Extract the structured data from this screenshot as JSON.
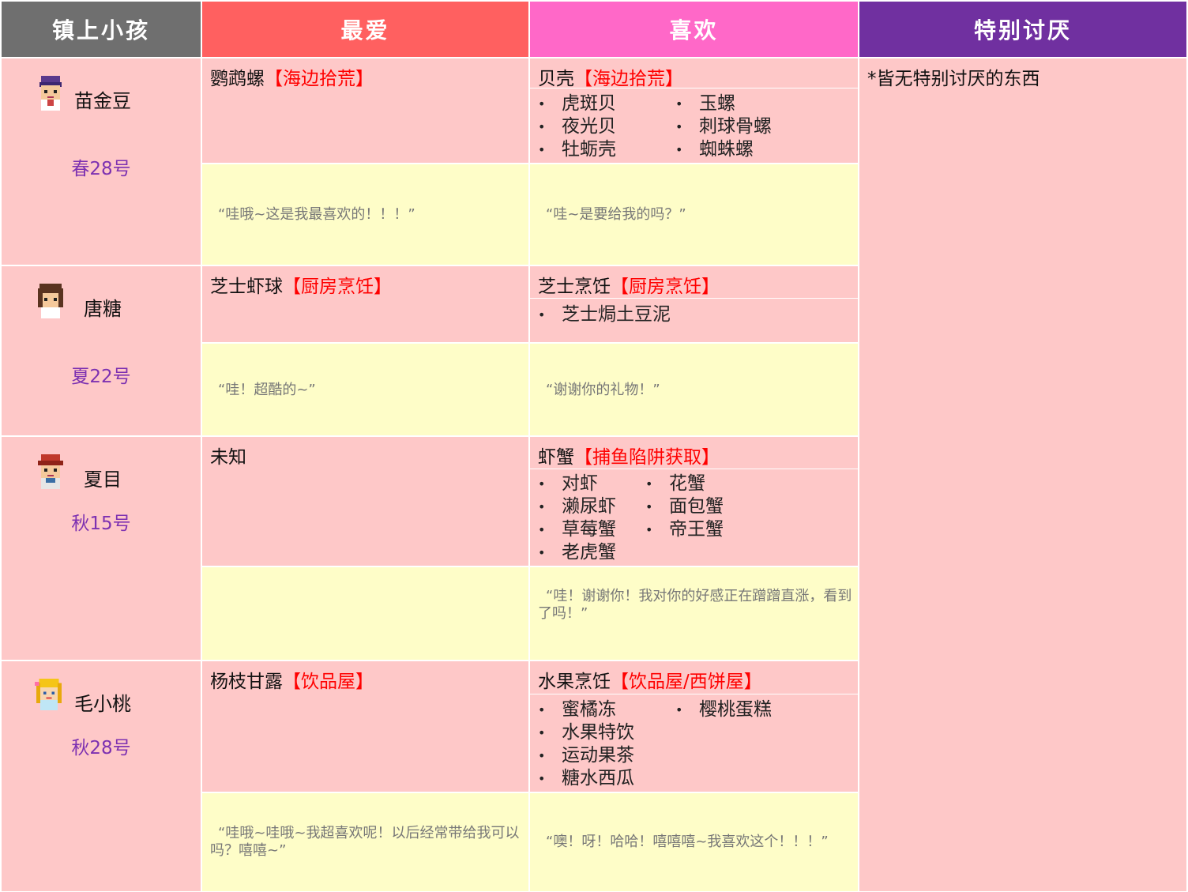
{
  "headers": {
    "kids": "镇上小孩",
    "love": "最爱",
    "like": "喜欢",
    "hate": "特别讨厌"
  },
  "colors": {
    "kids_header": "#6f6f6f",
    "love_header": "#ff6060",
    "like_header": "#ff68c8",
    "hate_header": "#7030a0",
    "pink_cell": "#fec8c8",
    "yellow_cell": "#fefdc8",
    "birthday_text": "#7d31b1",
    "source_text": "#ff0000"
  },
  "hate_text": "*皆无特别讨厌的东西",
  "kids": [
    {
      "name": "苗金豆",
      "birthday": "春28号",
      "avatar": "purple-hair-boy-icon",
      "love_item": "鹦鹉螺",
      "love_source": "【海边拾荒】",
      "love_quote": "“哇哦~这是我最喜欢的！！！”",
      "like_item": "贝壳",
      "like_source": "【海边拾荒】",
      "like_col1": [
        "虎斑贝",
        "夜光贝",
        "牡蛎壳"
      ],
      "like_col2": [
        "玉螺",
        "刺球骨螺",
        "蜘蛛螺"
      ],
      "like_quote": "“哇~是要给我的吗？”"
    },
    {
      "name": "唐糖",
      "birthday": "夏22号",
      "avatar": "brown-hair-girl-icon",
      "love_item": "芝士虾球",
      "love_source": "【厨房烹饪】",
      "love_quote": "“哇！超酷的~”",
      "like_item": "芝士烹饪",
      "like_source": "【厨房烹饪】",
      "like_col1": [
        "芝士焗土豆泥"
      ],
      "like_col2": [],
      "like_quote": "“谢谢你的礼物！”"
    },
    {
      "name": "夏目",
      "birthday": "秋15号",
      "avatar": "red-hair-kid-icon",
      "love_item": "未知",
      "love_source": "",
      "love_quote": "",
      "like_item": "虾蟹",
      "like_source": "【捕鱼陷阱获取】",
      "like_col1": [
        "对虾",
        "濑尿虾",
        "草莓蟹",
        "老虎蟹"
      ],
      "like_col2": [
        "花蟹",
        "面包蟹",
        "帝王蟹"
      ],
      "like_quote": "“哇！谢谢你！我对你的好感正在蹭蹭直涨，看到了吗！”"
    },
    {
      "name": "毛小桃",
      "birthday": "秋28号",
      "avatar": "blonde-girl-icon",
      "love_item": "杨枝甘露",
      "love_source": "【饮品屋】",
      "love_quote": "“哇哦~哇哦~我超喜欢呢！以后经常带给我可以吗？嘻嘻~”",
      "like_item": "水果烹饪",
      "like_source": "【饮品屋/西饼屋】",
      "like_col1": [
        "蜜橘冻",
        "水果特饮",
        "运动果茶",
        "糖水西瓜"
      ],
      "like_col2": [
        "樱桃蛋糕"
      ],
      "like_quote": "“噢！呀！哈哈！嘻嘻嘻~我喜欢这个！！！”"
    }
  ]
}
